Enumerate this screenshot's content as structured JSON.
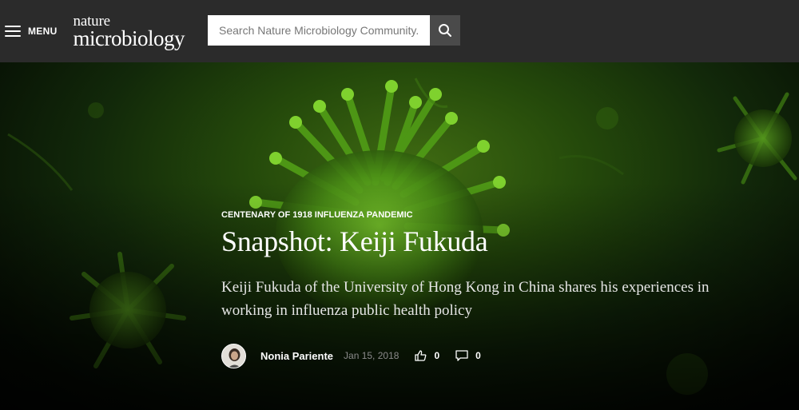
{
  "header": {
    "menu_label": "MENU",
    "logo_top": "nature",
    "logo_bottom": "microbiology",
    "search_placeholder": "Search Nature Microbiology Community..."
  },
  "hero": {
    "kicker": "CENTENARY OF 1918 INFLUENZA PANDEMIC",
    "title": "Snapshot: Keiji Fukuda",
    "standfirst": "Keiji Fukuda of the University of Hong Kong in China shares his experiences in working in influenza public health policy",
    "author": "Nonia Pariente",
    "date": "Jan 15, 2018",
    "likes": "0",
    "comments": "0"
  },
  "colors": {
    "topbar": "#2b2b2b",
    "search_button": "#4a4a4a",
    "virus_green": "#6fbf2a"
  },
  "icons": {
    "menu": "hamburger-icon",
    "search": "search-icon",
    "like": "thumbs-up-icon",
    "comment": "comment-icon"
  }
}
